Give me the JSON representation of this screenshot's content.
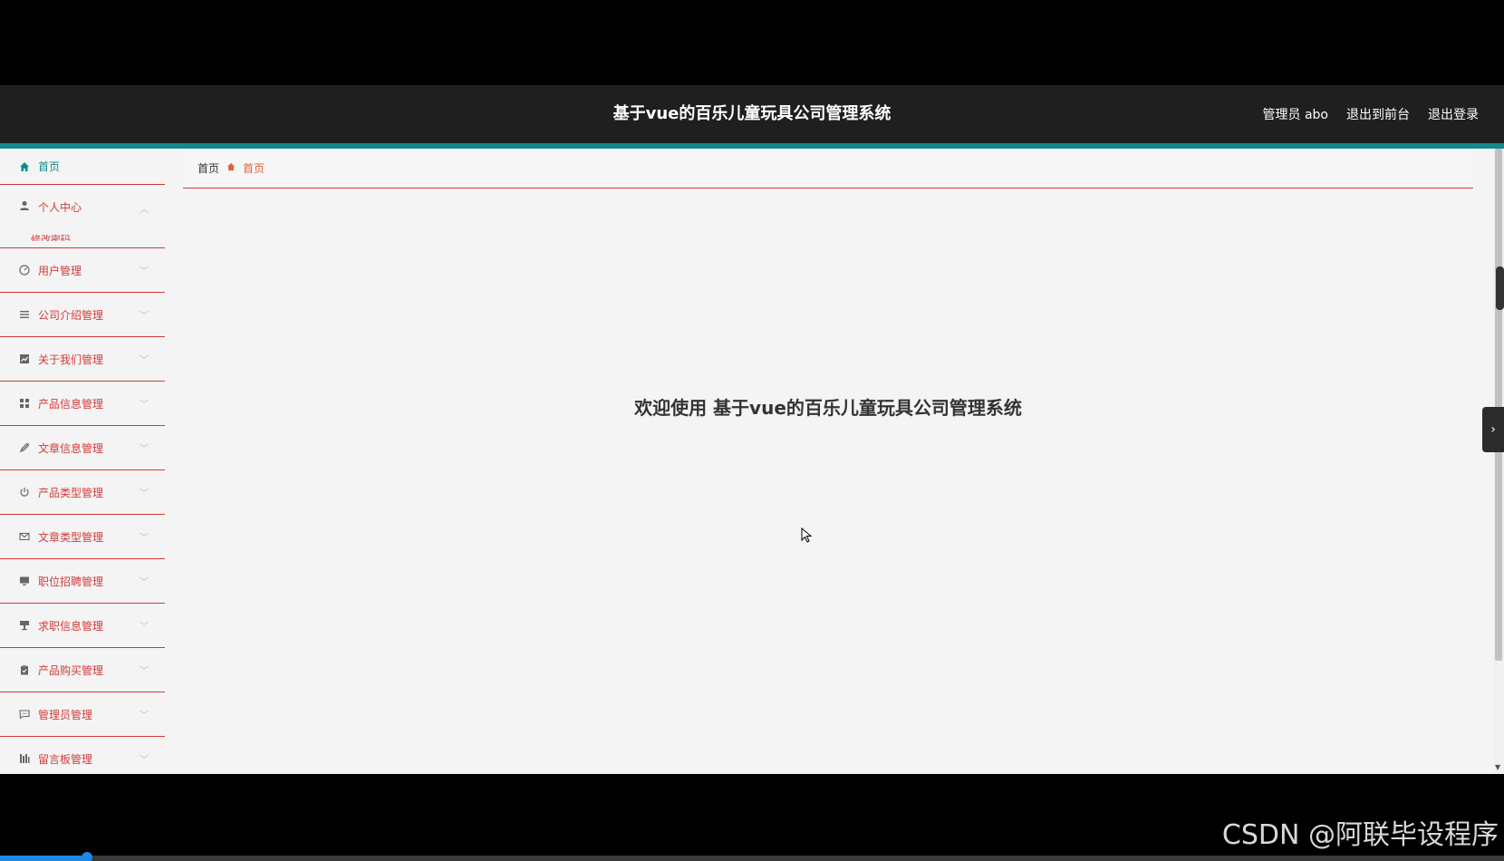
{
  "header": {
    "title": "基于vue的百乐儿童玩具公司管理系统",
    "user": "管理员 abo",
    "to_front": "退出到前台",
    "logout": "退出登录"
  },
  "sidebar": {
    "items": [
      {
        "label": "首页",
        "icon": "home-icon"
      },
      {
        "label": "个人中心",
        "icon": "user-icon",
        "submenu_partial": "修改密码"
      },
      {
        "label": "用户管理",
        "icon": "gauge-icon"
      },
      {
        "label": "公司介绍管理",
        "icon": "list-icon"
      },
      {
        "label": "关于我们管理",
        "icon": "chart-icon"
      },
      {
        "label": "产品信息管理",
        "icon": "grid-icon"
      },
      {
        "label": "文章信息管理",
        "icon": "pen-icon"
      },
      {
        "label": "产品类型管理",
        "icon": "power-icon"
      },
      {
        "label": "文章类型管理",
        "icon": "mail-icon"
      },
      {
        "label": "职位招聘管理",
        "icon": "monitor-icon"
      },
      {
        "label": "求职信息管理",
        "icon": "stamp-icon"
      },
      {
        "label": "产品购买管理",
        "icon": "clipboard-icon"
      },
      {
        "label": "管理员管理",
        "icon": "message-icon"
      },
      {
        "label": "留言板管理",
        "icon": "bars-icon"
      }
    ]
  },
  "breadcrumb": {
    "root": "首页",
    "current": "首页"
  },
  "main": {
    "welcome": "欢迎使用 基于vue的百乐儿童玩具公司管理系统"
  },
  "watermark": "CSDN @阿联毕设程序",
  "video_progress": 0.058,
  "colors": {
    "accent": "#0f8b8d",
    "menu_text": "#d23a3a",
    "breadcrumb_current": "#e0603a"
  }
}
